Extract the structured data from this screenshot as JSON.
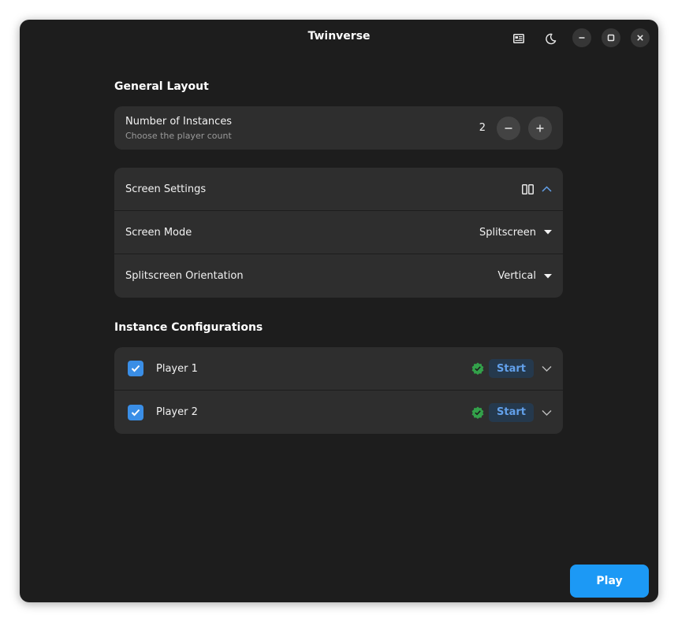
{
  "window": {
    "title": "Twinverse"
  },
  "general_layout": {
    "heading": "General Layout",
    "instances": {
      "label": "Number of Instances",
      "sublabel": "Choose the player count",
      "value": "2"
    }
  },
  "screen_settings": {
    "label": "Screen Settings",
    "screen_mode": {
      "label": "Screen Mode",
      "value": "Splitscreen"
    },
    "orientation": {
      "label": "Splitscreen Orientation",
      "value": "Vertical"
    }
  },
  "instance_configurations": {
    "heading": "Instance Configurations",
    "players": [
      {
        "label": "Player 1",
        "checked": true,
        "status": "ok",
        "button": "Start"
      },
      {
        "label": "Player 2",
        "checked": true,
        "status": "ok",
        "button": "Start"
      }
    ]
  },
  "play_button": "Play",
  "colors": {
    "window_bg": "#1d1d1d",
    "card_bg": "#2e2e2e",
    "accent": "#3584e4",
    "success": "#33a14a",
    "start_text": "#62a0ea"
  },
  "icons": {
    "header": [
      "layout-icon",
      "dark-mode-icon",
      "minimize-icon",
      "maximize-icon",
      "close-icon"
    ]
  }
}
